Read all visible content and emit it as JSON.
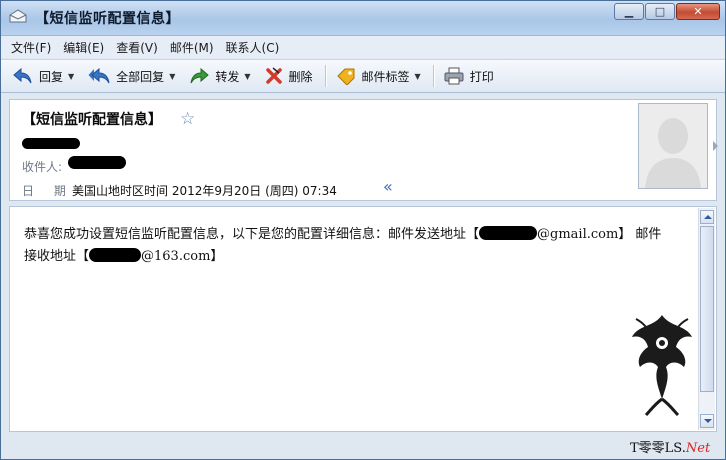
{
  "window": {
    "title": "【短信监听配置信息】"
  },
  "menu": {
    "items": [
      "文件(F)",
      "编辑(E)",
      "查看(V)",
      "邮件(M)",
      "联系人(C)"
    ]
  },
  "toolbar": {
    "reply": "回复",
    "reply_all": "全部回复",
    "forward": "转发",
    "delete": "删除",
    "tag": "邮件标签",
    "print": "打印"
  },
  "header": {
    "subject": "【短信监听配置信息】",
    "recipient_label": "收件人:",
    "date_label": "日 期:",
    "date_value": "美国山地时区时间 2012年9月20日 (周四) 07:34"
  },
  "body": {
    "line1_prefix": "恭喜您成功设置短信监听配置信息，以下是您的配置详细信息：邮件发送地址【",
    "line1_suffix": "@gmail.com】 邮件",
    "line2_prefix": "接收地址【",
    "line2_suffix": "@163.com】"
  },
  "watermark": {
    "text_main": "T零零LS.",
    "text_net": "Net"
  },
  "colors": {
    "accent": "#3d6cb5",
    "title_bar": "#b9d2ee",
    "close_button": "#c24c34"
  },
  "icons": [
    "app-envelope-icon",
    "reply-icon",
    "reply-all-icon",
    "forward-icon",
    "delete-icon",
    "tag-icon",
    "print-icon",
    "star-icon",
    "collapse-icon",
    "avatar-icon"
  ]
}
